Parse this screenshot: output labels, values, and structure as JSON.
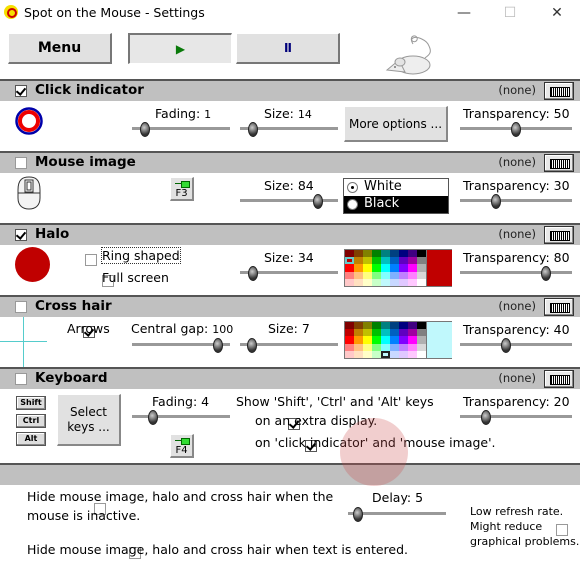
{
  "window": {
    "title": "Spot on the Mouse - Settings",
    "controls": {
      "minimize": "—",
      "maximize": "☐",
      "close": "✕"
    }
  },
  "toolbar": {
    "menu_label": "Menu",
    "play_icon": "▶",
    "pause_icon": "II",
    "play_state": "pressed"
  },
  "sections": {
    "click_indicator": {
      "label": "Click indicator",
      "enabled": true,
      "hotkey": "(none)",
      "fading_label": "Fading:",
      "fading_value": "1",
      "fading_fraction": 0.08,
      "size_label": "Size:",
      "size_value": "14",
      "size_fraction": 0.08,
      "more_options_label": "More options ...",
      "transparency_label": "Transparency:",
      "transparency_value": "50",
      "transparency_fraction": 0.5
    },
    "mouse_image": {
      "label": "Mouse image",
      "enabled": false,
      "hotkey": "(none)",
      "pin_key": "F3",
      "size_label": "Size:",
      "size_value": "84",
      "size_fraction": 0.84,
      "color_options": [
        "White",
        "Black"
      ],
      "color_selected": "White",
      "transparency_label": "Transparency:",
      "transparency_value": "30",
      "transparency_fraction": 0.3
    },
    "halo": {
      "label": "Halo",
      "enabled": true,
      "hotkey": "(none)",
      "ring_shaped_label": "Ring shaped",
      "ring_shaped": false,
      "full_screen_label": "Full screen",
      "full_screen": false,
      "size_label": "Size:",
      "size_value": "34",
      "size_fraction": 0.08,
      "selected_color": "#c00000",
      "transparency_label": "Transparency:",
      "transparency_value": "80",
      "transparency_fraction": 0.8
    },
    "cross_hair": {
      "label": "Cross hair",
      "enabled": false,
      "hotkey": "(none)",
      "arrows_label": "Arrows",
      "arrows": true,
      "central_gap_label": "Central gap:",
      "central_gap_value": "100",
      "central_gap_fraction": 1.0,
      "size_label": "Size:",
      "size_value": "7",
      "size_fraction": 0.07,
      "selected_color": "#c0f8fc",
      "transparency_label": "Transparency:",
      "transparency_value": "40",
      "transparency_fraction": 0.4
    },
    "keyboard": {
      "label": "Keyboard",
      "enabled": false,
      "hotkey": "(none)",
      "keys": [
        "Shift",
        "Ctrl",
        "Alt"
      ],
      "select_keys_label": "Select keys ...",
      "fading_label": "Fading:",
      "fading_value": "4",
      "fading_fraction": 0.18,
      "pin_key": "F4",
      "show_keys_label": "Show 'Shift', 'Ctrl' and 'Alt' keys",
      "extra_display_label": "on an extra display.",
      "extra_display": true,
      "on_indicator_label": "on 'click indicator' and 'mouse image'.",
      "on_indicator": true,
      "transparency_label": "Transparency:",
      "transparency_value": "20",
      "transparency_fraction": 0.2
    }
  },
  "bottom": {
    "hide_inactive_label_1": "Hide mouse image, halo and cross hair when the",
    "hide_inactive_label_2": "mouse is inactive.",
    "hide_inactive": false,
    "delay_label": "Delay:",
    "delay_value": "5",
    "delay_fraction": 0.05,
    "low_refresh_label_1": "Low refresh rate.",
    "low_refresh_label_2": "Might reduce",
    "low_refresh_label_3": "graphical problems.",
    "low_refresh": false,
    "hide_text_label": "Hide mouse image, halo and cross hair when text is entered.",
    "hide_text": false
  },
  "palette_colors": [
    [
      "#800000",
      "#804000",
      "#808000",
      "#008000",
      "#008080",
      "#004080",
      "#000080",
      "#400080",
      "#000000"
    ],
    [
      "#c00000",
      "#c08000",
      "#c0c000",
      "#00c000",
      "#00c0c0",
      "#0060c0",
      "#6000c0",
      "#a000a0",
      "#808080"
    ],
    [
      "#ff0000",
      "#ff9900",
      "#ffff00",
      "#00ff00",
      "#00ffff",
      "#0080ff",
      "#8000ff",
      "#ff00ff",
      "#b0b0b0"
    ],
    [
      "#ff8080",
      "#ffc080",
      "#ffff80",
      "#80ff80",
      "#80ffff",
      "#80b0ff",
      "#c080ff",
      "#ff80ff",
      "#d8d8d8"
    ],
    [
      "#ffc8c8",
      "#ffe0c0",
      "#ffffc8",
      "#c8ffc8",
      "#c0f8fc",
      "#c8d8ff",
      "#e0c8ff",
      "#ffc8ff",
      "#ffffff"
    ]
  ]
}
